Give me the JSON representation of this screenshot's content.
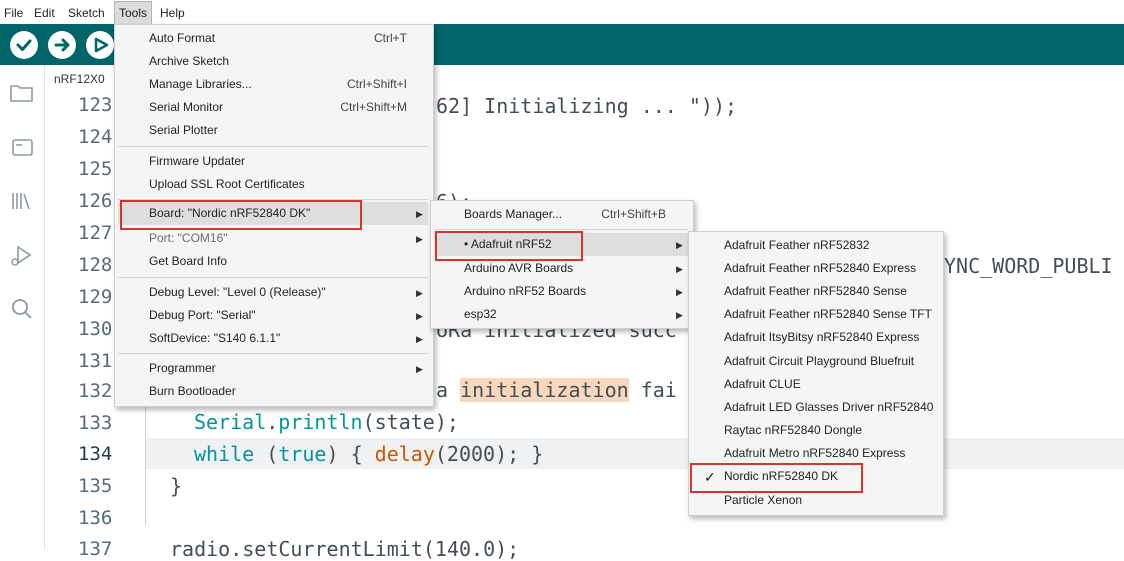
{
  "menubar": {
    "file": "File",
    "edit": "Edit",
    "sketch": "Sketch",
    "tools": "Tools",
    "help": "Help"
  },
  "toolbar": {
    "verify_icon": "check-circle-icon",
    "upload_icon": "arrow-right-circle-icon",
    "debug_icon": "debug-icon"
  },
  "sidebar": {
    "icons": [
      "folder-icon",
      "board-icon",
      "library-icon",
      "debug-icon",
      "search-icon"
    ]
  },
  "editor": {
    "tab_name": "nRF12X0",
    "line_numbers": [
      "123",
      "124",
      "125",
      "126",
      "127",
      "128",
      "129",
      "130",
      "131",
      "132",
      "133",
      "134",
      "135",
      "136",
      "137"
    ],
    "current_line": "134",
    "lines": {
      "l123": "62] Initializing ... \"));",
      "l126": "6);",
      "l128": "YNC_WORD_PUBLI",
      "l130": "oRa initialized succ",
      "l132_a": "a ",
      "l132_b": "initialization",
      "l132_c": " fai",
      "l133_a": "Serial",
      "l133_b": ".",
      "l133_c": "println",
      "l133_d": "(state);",
      "l134_a": "while",
      "l134_b": " (",
      "l134_c": "true",
      "l134_d": ") { ",
      "l134_e": "delay",
      "l134_f": "(2000); }",
      "l135": "}",
      "l137": "radio.setCurrentLimit(140.0);"
    }
  },
  "tools_menu": {
    "auto_format": "Auto Format",
    "auto_format_sc": "Ctrl+T",
    "archive": "Archive Sketch",
    "manage_libs": "Manage Libraries...",
    "manage_libs_sc": "Ctrl+Shift+I",
    "serial_monitor": "Serial Monitor",
    "serial_monitor_sc": "Ctrl+Shift+M",
    "serial_plotter": "Serial Plotter",
    "firmware_updater": "Firmware Updater",
    "upload_ssl": "Upload SSL Root Certificates",
    "board": "Board: \"Nordic nRF52840 DK\"",
    "port": "Port: \"COM16\"",
    "board_info": "Get Board Info",
    "debug_level": "Debug Level: \"Level 0 (Release)\"",
    "debug_port": "Debug Port: \"Serial\"",
    "softdevice": "SoftDevice: \"S140 6.1.1\"",
    "programmer": "Programmer",
    "burn_bootloader": "Burn Bootloader"
  },
  "board_menu": {
    "boards_manager": "Boards Manager...",
    "boards_manager_sc": "Ctrl+Shift+B",
    "adafruit_nrf52": "• Adafruit nRF52",
    "arduino_avr": "Arduino AVR Boards",
    "arduino_nrf52": "Arduino nRF52 Boards",
    "esp32": "esp32"
  },
  "adafruit_menu": {
    "items": [
      "Adafruit Feather nRF52832",
      "Adafruit Feather nRF52840 Express",
      "Adafruit Feather nRF52840 Sense",
      "Adafruit Feather nRF52840 Sense TFT",
      "Adafruit ItsyBitsy nRF52840 Express",
      "Adafruit Circuit Playground Bluefruit",
      "Adafruit CLUE",
      "Adafruit LED Glasses Driver nRF52840",
      "Raytac nRF52840 Dongle",
      "Adafruit Metro nRF52840 Express",
      "Nordic nRF52840 DK",
      "Particle Xenon"
    ],
    "checked": "✓"
  },
  "colors": {
    "toolbar": "#006468",
    "highlight_box": "#d9332e",
    "keyword": "#d35400",
    "type": "#00979c"
  }
}
